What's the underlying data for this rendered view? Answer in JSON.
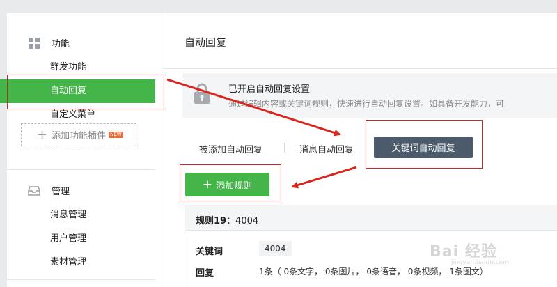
{
  "colors": {
    "accent_green": "#44b549",
    "dark_tab": "#4c5b6c",
    "annotation_red": "#c62a2a"
  },
  "sidebar": {
    "section1": {
      "label": "功能",
      "icon": "grid-icon"
    },
    "items": [
      {
        "label": "群发功能",
        "active": false
      },
      {
        "label": "自动回复",
        "active": true
      },
      {
        "label": "自定义菜单",
        "active": false
      }
    ],
    "add_plugin": {
      "label": "添加功能插件",
      "badge": "NEW"
    },
    "section2": {
      "label": "管理",
      "icon": "inbox-icon"
    },
    "manage_items": [
      {
        "label": "消息管理"
      },
      {
        "label": "用户管理"
      },
      {
        "label": "素材管理"
      }
    ]
  },
  "main": {
    "title": "自动回复",
    "notice": {
      "icon": "lock-icon",
      "title": "已开启自动回复设置",
      "desc": "通过编辑内容或关键词规则，快速进行自动回复设置。如具备开发能力，可"
    },
    "tabs": [
      {
        "label": "被添加自动回复",
        "active": false
      },
      {
        "label": "消息自动回复",
        "active": false
      },
      {
        "label": "关键词自动回复",
        "active": true
      }
    ],
    "add_rule_label": "添加规则",
    "rule": {
      "name_prefix": "规则19",
      "name_value": "：4004",
      "keyword_label": "关键词",
      "keyword_value": "4004",
      "reply_label": "回复",
      "reply_value": "1条（ 0条文字， 0条图片， 0条语音， 0条视频， 1条图文）"
    }
  },
  "watermark": {
    "text": "Bai 经验",
    "sub": "jingyan.baidu.com"
  }
}
